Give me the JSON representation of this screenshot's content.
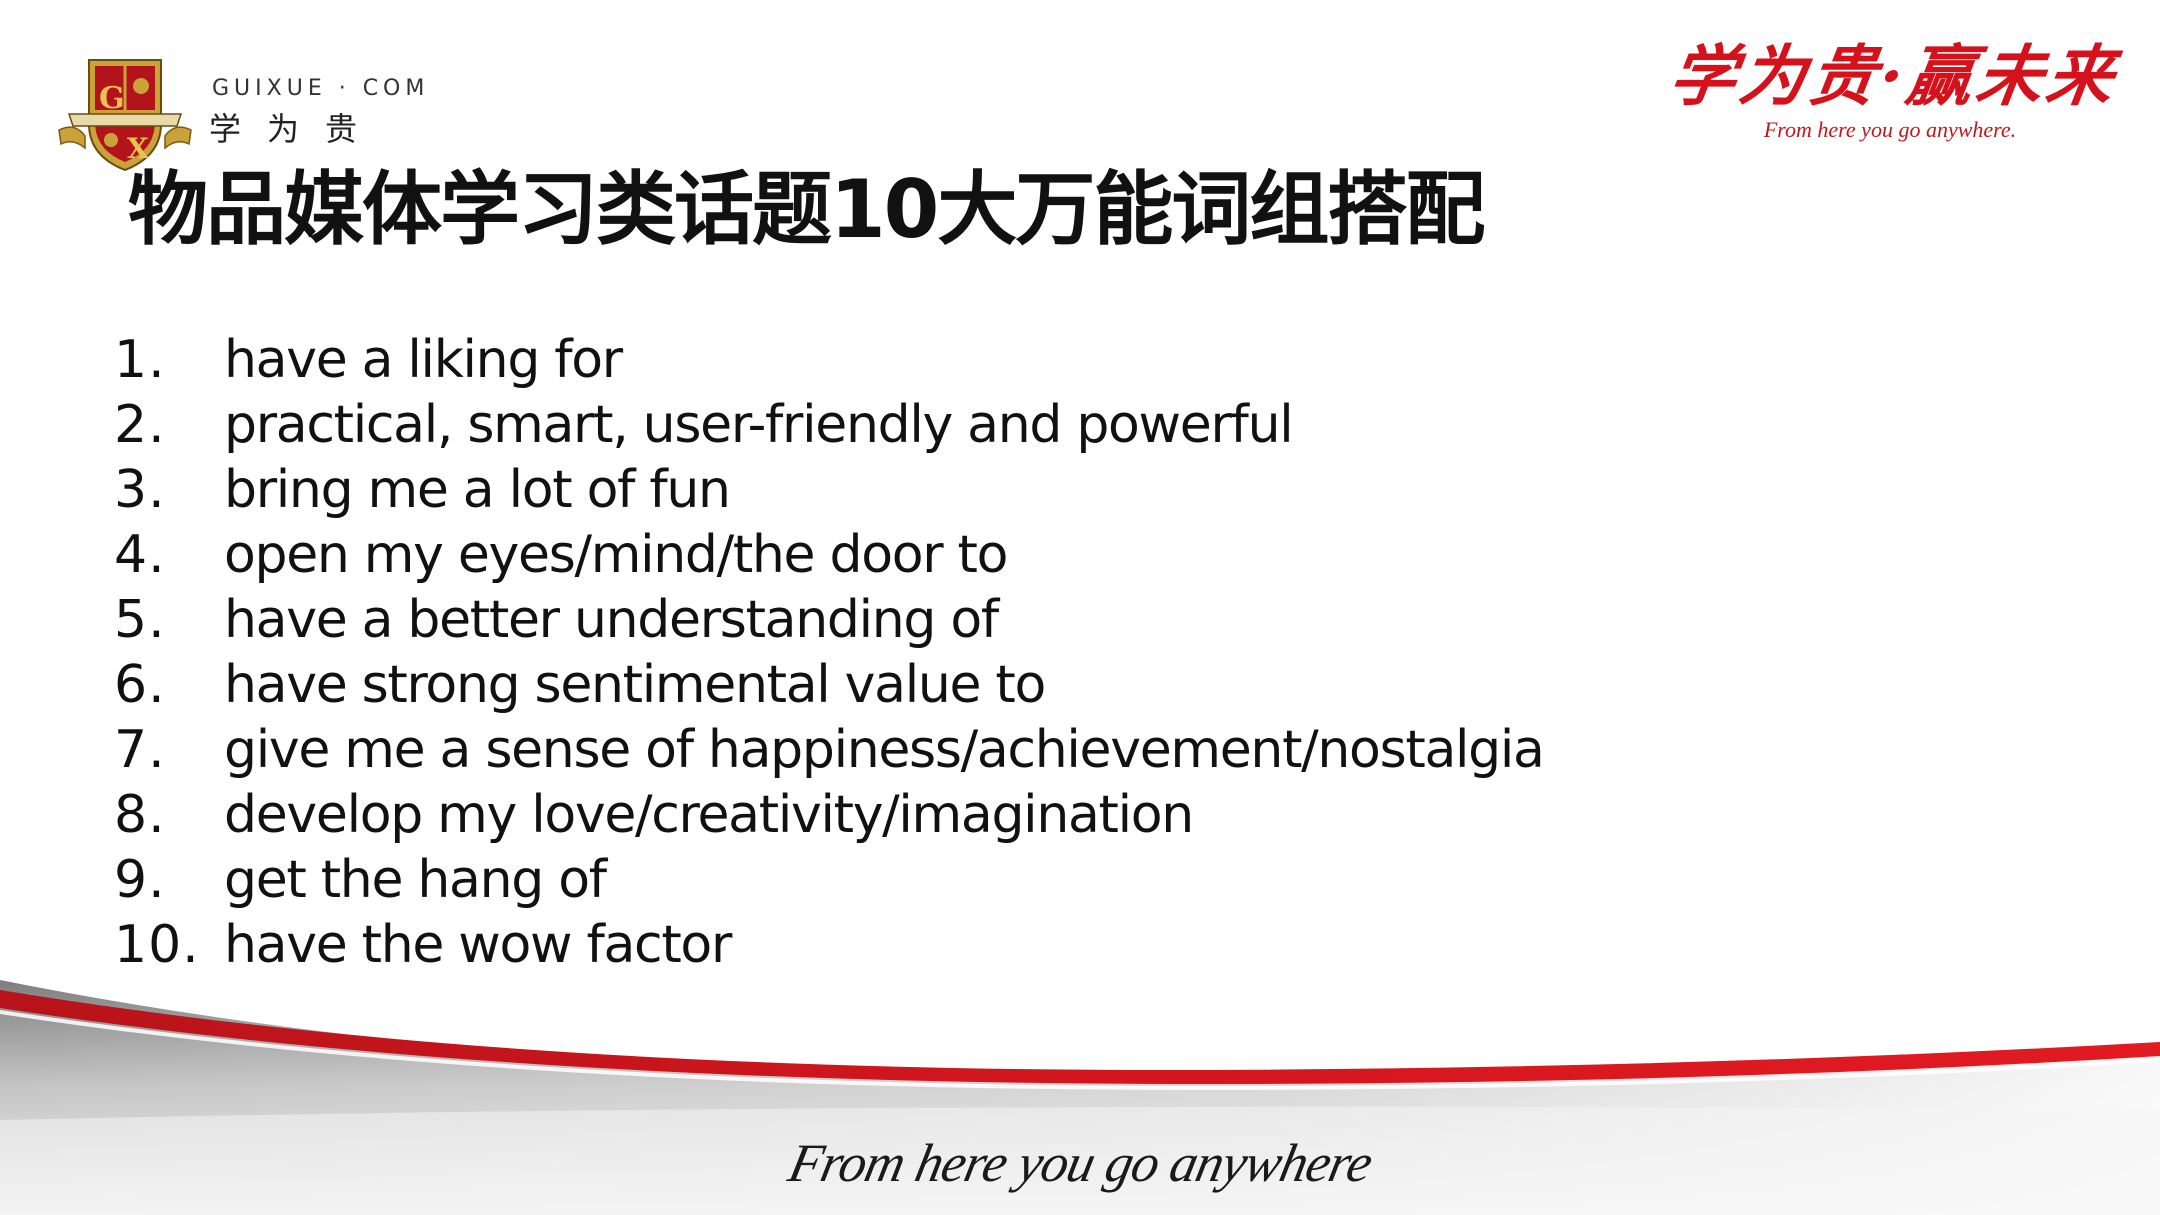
{
  "logo": {
    "domain": "GUIXUE · COM",
    "brand_cn": "学为贵",
    "crest_letters": [
      "G",
      "X"
    ]
  },
  "slogan": {
    "cn": "学为贵·赢未来",
    "en": "From here you go anywhere."
  },
  "title": "物品媒体学习类话题10大万能词组搭配",
  "phrases": [
    {
      "num": "1.",
      "text": "have a liking for"
    },
    {
      "num": "2.",
      "text": "practical, smart, user-friendly and powerful"
    },
    {
      "num": "3.",
      "text": "bring me a lot of fun"
    },
    {
      "num": "4.",
      "text": "open my eyes/mind/the door to"
    },
    {
      "num": "5.",
      "text": "have a better understanding of"
    },
    {
      "num": "6.",
      "text": "have strong sentimental value to"
    },
    {
      "num": "7.",
      "text": "give me a sense of happiness/achievement/nostalgia"
    },
    {
      "num": "8.",
      "text": "develop my love/creativity/imagination"
    },
    {
      "num": "9.",
      "text": "get the hang of"
    },
    {
      "num": "10.",
      "text": "have the wow factor"
    }
  ],
  "footer": {
    "tagline": "From here you go anywhere"
  },
  "colors": {
    "brand_red": "#d5121b",
    "text": "#111111",
    "gray_band": "#9a9a9a"
  }
}
